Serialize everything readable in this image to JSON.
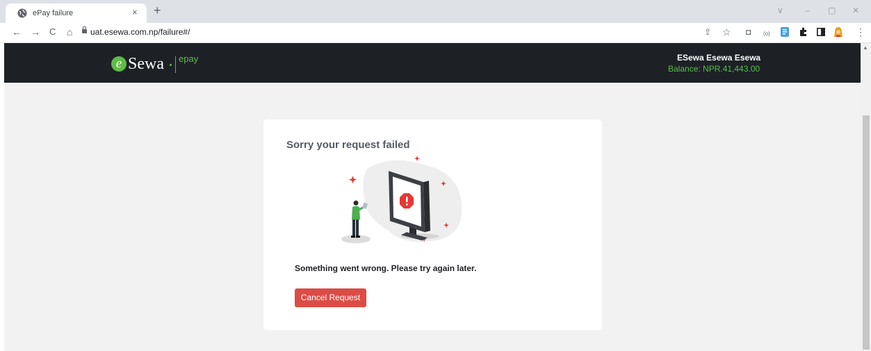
{
  "browser": {
    "tab_title": "ePay failure",
    "tab_close": "×",
    "new_tab": "+",
    "window_controls": {
      "tab_search": "∨",
      "minimize": "–",
      "restore": "▢",
      "close": "✕"
    },
    "nav": {
      "back": "←",
      "forward": "→",
      "reload": "C",
      "home": "⌂"
    },
    "url": "uat.esewa.com.np/failure#/",
    "extensions": {
      "share": "⇪",
      "bookmark": "☆",
      "camera": "◘",
      "radio": "(o)",
      "menu": "⋮"
    }
  },
  "header": {
    "logo_e": "e",
    "logo_sewa": "Sewa",
    "logo_epay": "epay",
    "user_name": "ESewa Esewa Esewa",
    "balance": "Balance: NPR.41,443.00"
  },
  "card": {
    "title": "Sorry your request failed",
    "message": "Something went wrong. Please try again later.",
    "cancel_label": "Cancel Request",
    "illustration_icon": "error-monitor-illustration"
  },
  "colors": {
    "header_bg": "#1d2126",
    "brand_green": "#60bb46",
    "balance_green": "#53c244",
    "danger": "#dc4c45",
    "page_bg": "#f2f2f2"
  }
}
